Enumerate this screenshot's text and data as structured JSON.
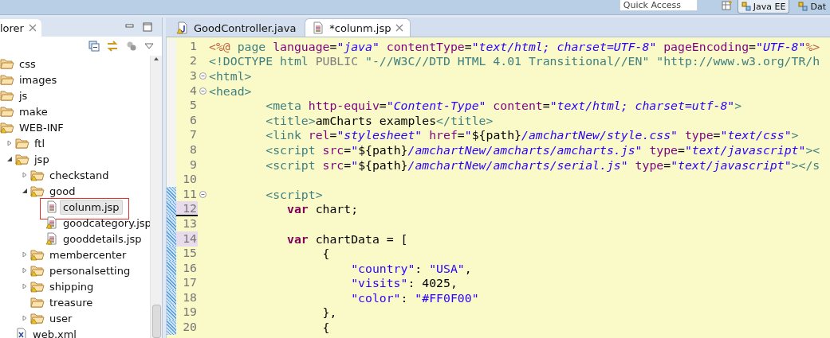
{
  "toolbar": {
    "quick_access": {
      "placeholder": "Quick Access"
    },
    "perspectives": [
      {
        "label": "Java EE",
        "selected": true
      },
      {
        "label": "Dat",
        "selected": false
      }
    ]
  },
  "explorer": {
    "title": "lorer",
    "tree": [
      {
        "label": "css",
        "kind": "folder",
        "warning": false,
        "selected": false
      },
      {
        "label": "images",
        "kind": "folder",
        "warning": false,
        "selected": false
      },
      {
        "label": "js",
        "kind": "folder",
        "warning": false,
        "selected": false
      },
      {
        "label": "make",
        "kind": "folder",
        "warning": false,
        "selected": false
      },
      {
        "label": "WEB-INF",
        "kind": "folder",
        "warning": true,
        "selected": false,
        "children": [
          {
            "label": "ftl",
            "kind": "folder",
            "warning": false,
            "selected": false,
            "expanded": false
          },
          {
            "label": "jsp",
            "kind": "folder",
            "warning": true,
            "selected": false,
            "expanded": true,
            "children": [
              {
                "label": "checkstand",
                "kind": "folder",
                "warning": true,
                "selected": false,
                "expanded": false
              },
              {
                "label": "good",
                "kind": "folder",
                "warning": true,
                "selected": false,
                "expanded": true,
                "children": [
                  {
                    "label": "colunm.jsp",
                    "kind": "file",
                    "warning": false,
                    "selected": true,
                    "boxed": true
                  },
                  {
                    "label": "goodcategory.jsp",
                    "kind": "file",
                    "warning": true,
                    "selected": false
                  },
                  {
                    "label": "gooddetails.jsp",
                    "kind": "file",
                    "warning": true,
                    "selected": false
                  }
                ]
              },
              {
                "label": "membercenter",
                "kind": "folder",
                "warning": true,
                "selected": false,
                "expanded": false
              },
              {
                "label": "personalsetting",
                "kind": "folder",
                "warning": true,
                "selected": false,
                "expanded": false
              },
              {
                "label": "shipping",
                "kind": "folder",
                "warning": true,
                "selected": false,
                "expanded": false
              },
              {
                "label": "treasure",
                "kind": "folder",
                "warning": false,
                "selected": false
              },
              {
                "label": "user",
                "kind": "folder",
                "warning": true,
                "selected": false,
                "expanded": false
              }
            ]
          },
          {
            "label": "web.xml",
            "kind": "xml",
            "warning": false,
            "selected": false
          }
        ]
      }
    ]
  },
  "editor": {
    "tabs": [
      {
        "label": "GoodController.java",
        "kind": "java",
        "warning": true,
        "selected": false
      },
      {
        "label": "*colunm.jsp",
        "kind": "jsp",
        "warning": false,
        "selected": true
      }
    ],
    "lines": [
      {
        "number": "1",
        "fold": false,
        "changed": false,
        "highlighted": false,
        "current": false,
        "tokens": [
          {
            "kind": "directive",
            "text": "<%@"
          },
          {
            "kind": "tag",
            "text": " page "
          },
          {
            "kind": "attr",
            "text": "language"
          },
          {
            "kind": "plain",
            "text": "="
          },
          {
            "kind": "value",
            "text": "\"java\""
          },
          {
            "kind": "attr",
            "text": " contentType"
          },
          {
            "kind": "plain",
            "text": "="
          },
          {
            "kind": "value",
            "text": "\"text/html; charset=UTF-8\""
          },
          {
            "kind": "attr",
            "text": " pageEncoding"
          },
          {
            "kind": "plain",
            "text": "="
          },
          {
            "kind": "value",
            "text": "\"UTF-8\""
          },
          {
            "kind": "directive",
            "text": "%>"
          }
        ]
      },
      {
        "number": "2",
        "fold": false,
        "changed": false,
        "highlighted": false,
        "current": false,
        "tokens": [
          {
            "kind": "tag",
            "text": "<!DOCTYPE html "
          },
          {
            "kind": "doctype",
            "text": "PUBLIC"
          },
          {
            "kind": "tag",
            "text": " \"-//W3C//DTD HTML 4.01 Transitional//EN\" \"http://www.w3.org/TR/h"
          }
        ]
      },
      {
        "number": "3",
        "fold": true,
        "changed": false,
        "highlighted": false,
        "current": false,
        "tokens": [
          {
            "kind": "tag",
            "text": "<html>"
          }
        ]
      },
      {
        "number": "4",
        "fold": true,
        "changed": false,
        "highlighted": false,
        "current": false,
        "tokens": [
          {
            "kind": "tag",
            "text": "<head>"
          }
        ]
      },
      {
        "number": "5",
        "fold": false,
        "changed": false,
        "highlighted": false,
        "current": false,
        "tokens": [
          {
            "kind": "tag",
            "text": "        <meta "
          },
          {
            "kind": "attr",
            "text": "http-equiv"
          },
          {
            "kind": "plain",
            "text": "="
          },
          {
            "kind": "value",
            "text": "\"Content-Type\""
          },
          {
            "kind": "attr",
            "text": " content"
          },
          {
            "kind": "plain",
            "text": "="
          },
          {
            "kind": "value",
            "text": "\"text/html; charset=utf-8\""
          },
          {
            "kind": "tag",
            "text": ">"
          }
        ]
      },
      {
        "number": "6",
        "fold": false,
        "changed": false,
        "highlighted": false,
        "current": false,
        "tokens": [
          {
            "kind": "tag",
            "text": "        <title>"
          },
          {
            "kind": "plain",
            "text": "amCharts examples"
          },
          {
            "kind": "tag",
            "text": "</title>"
          }
        ]
      },
      {
        "number": "7",
        "fold": false,
        "changed": false,
        "highlighted": false,
        "current": false,
        "tokens": [
          {
            "kind": "tag",
            "text": "        <link "
          },
          {
            "kind": "attr",
            "text": "rel"
          },
          {
            "kind": "plain",
            "text": "="
          },
          {
            "kind": "value",
            "text": "\"stylesheet\""
          },
          {
            "kind": "attr",
            "text": " href"
          },
          {
            "kind": "plain",
            "text": "="
          },
          {
            "kind": "value",
            "text": "\""
          },
          {
            "kind": "plain",
            "text": "${path}"
          },
          {
            "kind": "value",
            "text": "/amchartNew/style.css\""
          },
          {
            "kind": "attr",
            "text": " type"
          },
          {
            "kind": "plain",
            "text": "="
          },
          {
            "kind": "value",
            "text": "\"text/css\""
          },
          {
            "kind": "tag",
            "text": ">"
          }
        ]
      },
      {
        "number": "8",
        "fold": false,
        "changed": false,
        "highlighted": false,
        "current": false,
        "tokens": [
          {
            "kind": "tag",
            "text": "        <script "
          },
          {
            "kind": "attr",
            "text": "src"
          },
          {
            "kind": "plain",
            "text": "="
          },
          {
            "kind": "value",
            "text": "\""
          },
          {
            "kind": "plain",
            "text": "${path}"
          },
          {
            "kind": "value",
            "text": "/amchartNew/amcharts/amcharts.js\""
          },
          {
            "kind": "attr",
            "text": " type"
          },
          {
            "kind": "plain",
            "text": "="
          },
          {
            "kind": "value",
            "text": "\"text/javascript\""
          },
          {
            "kind": "tag",
            "text": "><"
          }
        ]
      },
      {
        "number": "9",
        "fold": false,
        "changed": false,
        "highlighted": false,
        "current": false,
        "tokens": [
          {
            "kind": "tag",
            "text": "        <script "
          },
          {
            "kind": "attr",
            "text": "src"
          },
          {
            "kind": "plain",
            "text": "="
          },
          {
            "kind": "value",
            "text": "\""
          },
          {
            "kind": "plain",
            "text": "${path}"
          },
          {
            "kind": "value",
            "text": "/amchartNew/amcharts/serial.js\""
          },
          {
            "kind": "attr",
            "text": " type"
          },
          {
            "kind": "plain",
            "text": "="
          },
          {
            "kind": "value",
            "text": "\"text/javascript\""
          },
          {
            "kind": "tag",
            "text": "></s"
          }
        ]
      },
      {
        "number": "10",
        "fold": false,
        "changed": false,
        "highlighted": false,
        "current": false
      },
      {
        "number": "11",
        "fold": true,
        "changed": true,
        "highlighted": false,
        "current": false,
        "tokens": [
          {
            "kind": "tag",
            "text": "        <script>"
          }
        ]
      },
      {
        "number": "12",
        "fold": false,
        "changed": true,
        "highlighted": true,
        "current": true,
        "tokens": [
          {
            "kind": "keyword",
            "text": "           var"
          },
          {
            "kind": "plain",
            "text": " chart;"
          }
        ]
      },
      {
        "number": "13",
        "fold": false,
        "changed": true,
        "highlighted": false,
        "current": false
      },
      {
        "number": "14",
        "fold": false,
        "changed": true,
        "highlighted": true,
        "current": false,
        "tokens": [
          {
            "kind": "keyword",
            "text": "           var"
          },
          {
            "kind": "plain",
            "text": " chartData = ["
          }
        ]
      },
      {
        "number": "15",
        "fold": false,
        "changed": true,
        "highlighted": false,
        "current": false,
        "tokens": [
          {
            "kind": "plain",
            "text": "                {"
          }
        ]
      },
      {
        "number": "16",
        "fold": false,
        "changed": true,
        "highlighted": false,
        "current": false,
        "tokens": [
          {
            "kind": "string",
            "text": "                    \"country\""
          },
          {
            "kind": "plain",
            "text": ": "
          },
          {
            "kind": "string",
            "text": "\"USA\""
          },
          {
            "kind": "plain",
            "text": ","
          }
        ]
      },
      {
        "number": "17",
        "fold": false,
        "changed": true,
        "highlighted": false,
        "current": false,
        "tokens": [
          {
            "kind": "string",
            "text": "                    \"visits\""
          },
          {
            "kind": "plain",
            "text": ": 4025,"
          }
        ]
      },
      {
        "number": "18",
        "fold": false,
        "changed": true,
        "highlighted": false,
        "current": false,
        "tokens": [
          {
            "kind": "string",
            "text": "                    \"color\""
          },
          {
            "kind": "plain",
            "text": ": "
          },
          {
            "kind": "string",
            "text": "\"#FF0F00\""
          }
        ]
      },
      {
        "number": "19",
        "fold": false,
        "changed": true,
        "highlighted": false,
        "current": false,
        "tokens": [
          {
            "kind": "plain",
            "text": "                },"
          }
        ]
      },
      {
        "number": "20",
        "fold": false,
        "changed": true,
        "highlighted": false,
        "current": false,
        "tokens": [
          {
            "kind": "plain",
            "text": "                {"
          }
        ]
      }
    ]
  }
}
